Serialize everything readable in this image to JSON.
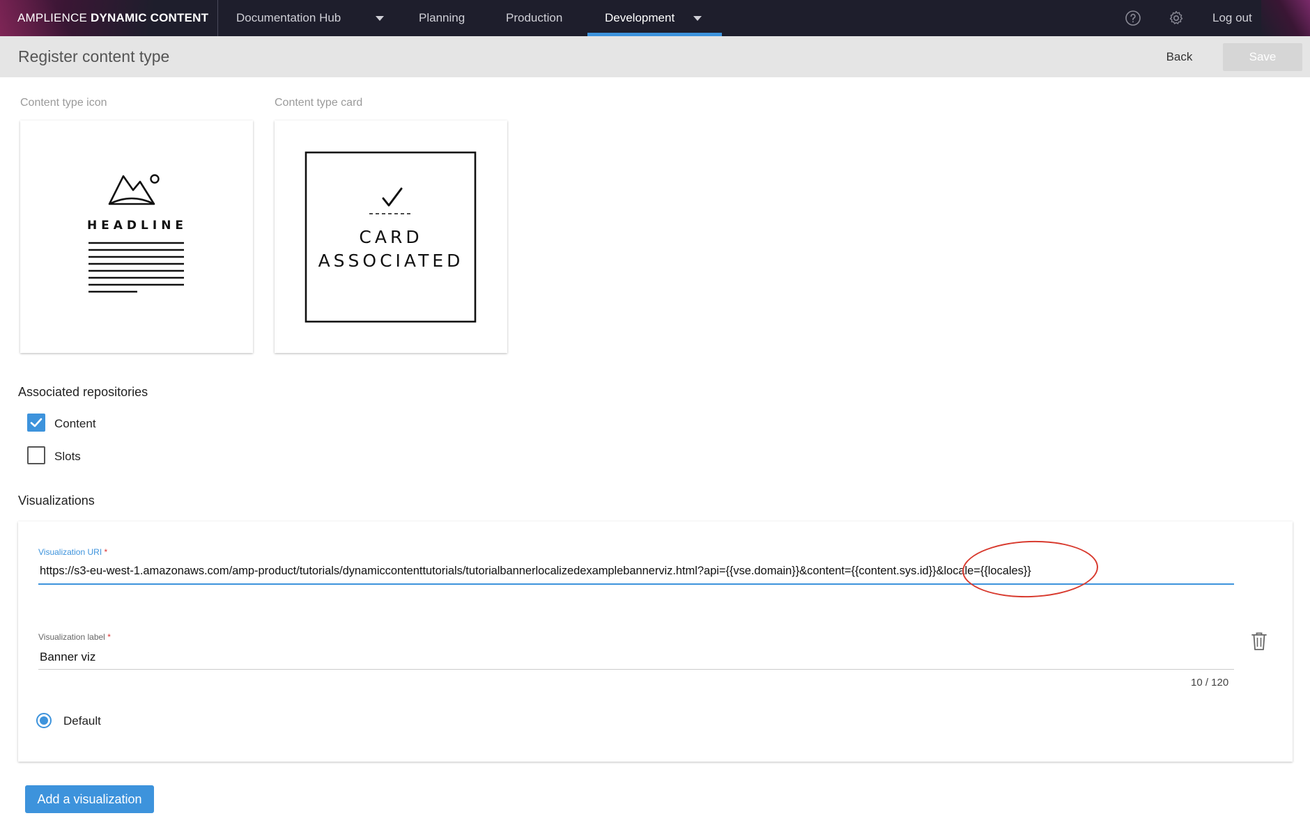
{
  "app": {
    "brand_prefix": "AMPLIENCE",
    "brand_name": "DYNAMIC CONTENT"
  },
  "nav": {
    "hub": "Documentation Hub",
    "planning": "Planning",
    "production": "Production",
    "development": "Development",
    "active": "Development",
    "logout": "Log out",
    "icons": [
      "help-icon",
      "gear-icon"
    ]
  },
  "header": {
    "title": "Register content type",
    "back_label": "Back",
    "save_label": "Save"
  },
  "icon_section": {
    "label": "Content type icon",
    "headline_text": "HEADLINE"
  },
  "card_section": {
    "label": "Content type card",
    "card_line1": "CARD",
    "card_line2": "ASSOCIATED"
  },
  "repositories": {
    "heading": "Associated repositories",
    "items": [
      {
        "label": "Content",
        "checked": true
      },
      {
        "label": "Slots",
        "checked": false
      }
    ]
  },
  "visualizations": {
    "heading": "Visualizations",
    "uri_label": "Visualization URI",
    "required_mark": "*",
    "uri_value": "https://s3-eu-west-1.amazonaws.com/amp-product/tutorials/dynamiccontenttutorials/tutorialbannerlocalizedexamplebannerviz.html?api={{vse.domain}}&content={{content.sys.id}}&locale={{locales}}",
    "label_label": "Visualization label",
    "label_value": "Banner viz",
    "counter": "10 / 120",
    "default_label": "Default",
    "add_label": "Add a visualization"
  },
  "colors": {
    "accent": "#3d93dc",
    "topbar": "#1e1e2c",
    "annotation": "#d83a2e",
    "required": "#dd3333"
  }
}
